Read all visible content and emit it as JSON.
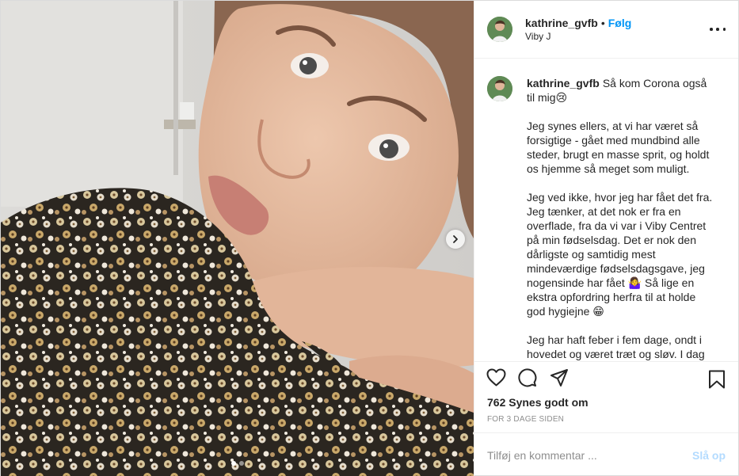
{
  "post": {
    "username": "kathrine_gvfb",
    "separator": "•",
    "follow_label": "Følg",
    "location": "Viby J",
    "more_icon": "more-horizontal-icon",
    "caption_paragraphs": [
      "Så kom Corona også til mig😢",
      "Jeg synes ellers, at vi har været så forsigtige - gået med mundbind alle steder, brugt en masse sprit, og holdt os hjemme så meget som muligt.",
      "Jeg ved ikke, hvor jeg har fået det fra. Jeg tænker, at det nok er fra en overflade, fra da vi var i Viby Centret på min fødselsdag. Det er nok den dårligste og samtidig mest mindeværdige fødselsdagsgave, jeg nogensinde har fået 🤷‍♀️ Så lige en ekstra opfordring herfra til at holde god hygiejne 😁",
      "Jeg har haft feber i fem dage, ondt i hovedet og været træt og sløv. I dag"
    ],
    "likes_text": "762 Synes godt om",
    "timestamp": "FOR 3 DAGE SIDEN",
    "comment_placeholder": "Tilføj en kommentar ...",
    "post_button_label": "Slå op",
    "carousel": {
      "slides": 2,
      "active_index": 0
    },
    "colors": {
      "accent": "#0095f6",
      "post_disabled": "#b3dbff",
      "muted": "#8e8e8e"
    },
    "icons": [
      "heart-icon",
      "comment-icon",
      "share-icon",
      "bookmark-icon",
      "chevron-right-icon"
    ]
  }
}
